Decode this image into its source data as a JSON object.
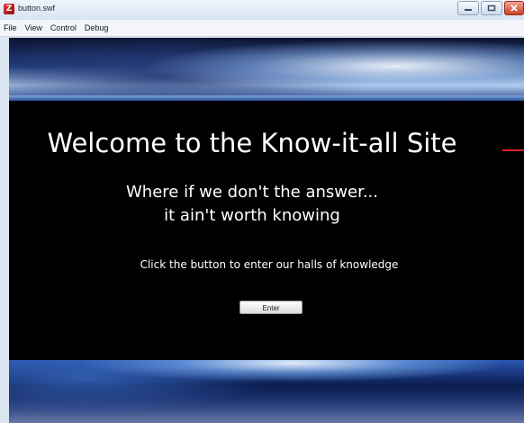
{
  "window": {
    "title": "button.swf",
    "app_icon_glyph": "Z",
    "icons": {
      "minimize": "minimize-icon",
      "maximize": "maximize-icon",
      "close": "close-icon"
    }
  },
  "menu": {
    "items": [
      "File",
      "View",
      "Control",
      "Debug"
    ]
  },
  "content": {
    "headline": "Welcome to the Know-it-all Site",
    "subline_1": "Where if we don't the answer...",
    "subline_2": "it ain't worth knowing",
    "instruction": "Click the button to enter our halls of knowledge",
    "enter_button": "Enter",
    "accent_color": "#e0241a"
  }
}
